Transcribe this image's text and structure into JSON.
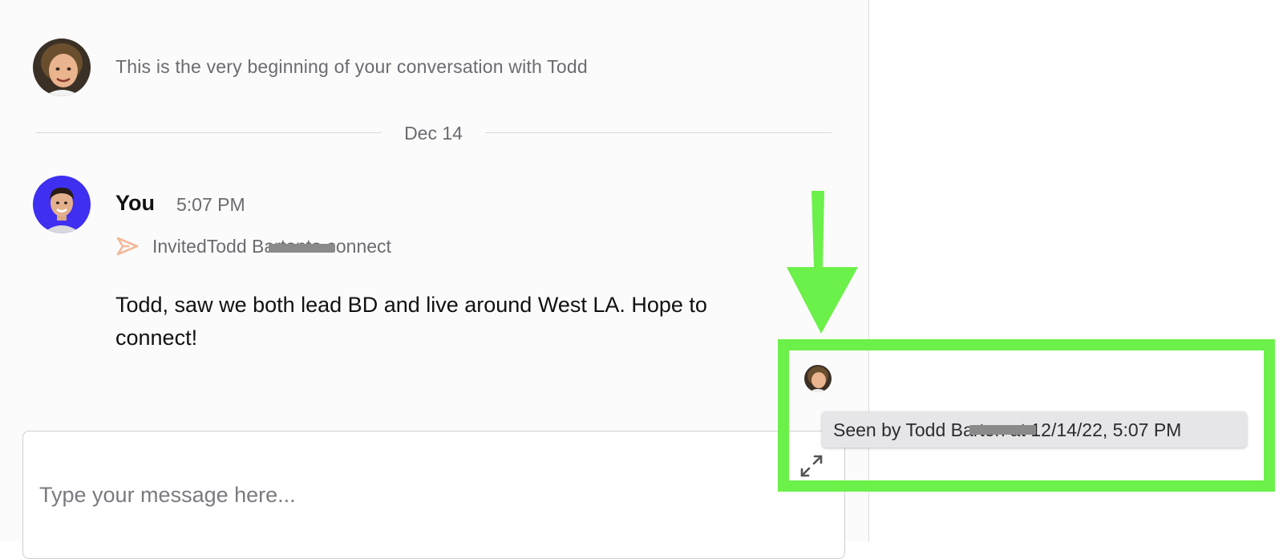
{
  "conversation": {
    "intro_text": "This is the very beginning of your conversation with Todd",
    "date_divider": "Dec 14"
  },
  "message": {
    "sender": "You",
    "time": "5:07 PM",
    "invite_text": "InvitedTodd Bartonto connect",
    "body": "Todd, saw we both lead BD and live around West LA. Hope to connect!"
  },
  "seen_tooltip": {
    "text": "Seen by Todd Barton at 12/14/22, 5:07 PM"
  },
  "composer": {
    "placeholder": "Type your message here..."
  },
  "annotation": {
    "highlight_color": "#6cf04a"
  },
  "colors": {
    "invite_icon": "#f3b999",
    "my_avatar_bg": "#3f2ff0"
  },
  "icons": {
    "invite": "send-icon",
    "expand": "expand-icon"
  }
}
